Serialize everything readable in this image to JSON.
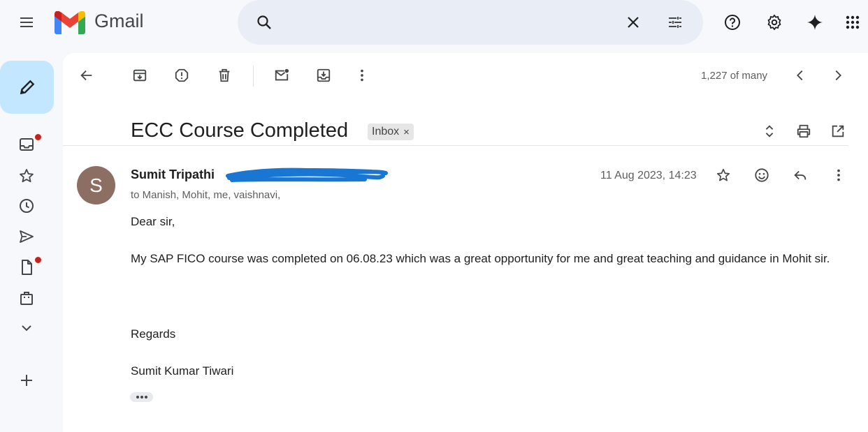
{
  "app": {
    "name": "Gmail"
  },
  "search": {
    "placeholder": ""
  },
  "toolbar": {
    "pager_text": "1,227 of many"
  },
  "email": {
    "subject": "ECC Course Completed",
    "label_chip": "Inbox",
    "label_close": "×",
    "avatar_letter": "S",
    "sender_name": "Sumit Tripathi",
    "recipients": "to Manish, Mohit, me, vaishnavi,",
    "date": "11 Aug 2023, 14:23",
    "body": {
      "greeting": "Dear sir,",
      "paragraph": "My SAP FICO course was completed on 06.08.23 which was a great opportunity for me and great teaching and guidance in Mohit sir.",
      "regards": "Regards",
      "signature": "Sumit Kumar Tiwari"
    }
  },
  "colors": {
    "compose_bg": "#c2e7ff",
    "search_bg": "#e9eef6",
    "avatar_bg": "#8d6e63",
    "notification_dot": "#c5221f",
    "scribble": "#1976d2"
  },
  "icons": [
    "menu-icon",
    "search-icon",
    "close-icon",
    "tune-icon",
    "help-icon",
    "gear-icon",
    "gemini-icon",
    "apps-icon",
    "pencil-icon",
    "inbox-icon",
    "star-icon",
    "clock-icon",
    "send-icon",
    "file-icon",
    "bag-icon",
    "chevron-down-icon",
    "plus-icon",
    "arrow-back-icon",
    "archive-icon",
    "report-icon",
    "trash-icon",
    "mark-unread-icon",
    "move-to-icon",
    "more-vert-icon",
    "chevron-left-icon",
    "chevron-right-icon",
    "expand-icon",
    "print-icon",
    "open-new-icon",
    "emoji-icon",
    "reply-icon"
  ]
}
